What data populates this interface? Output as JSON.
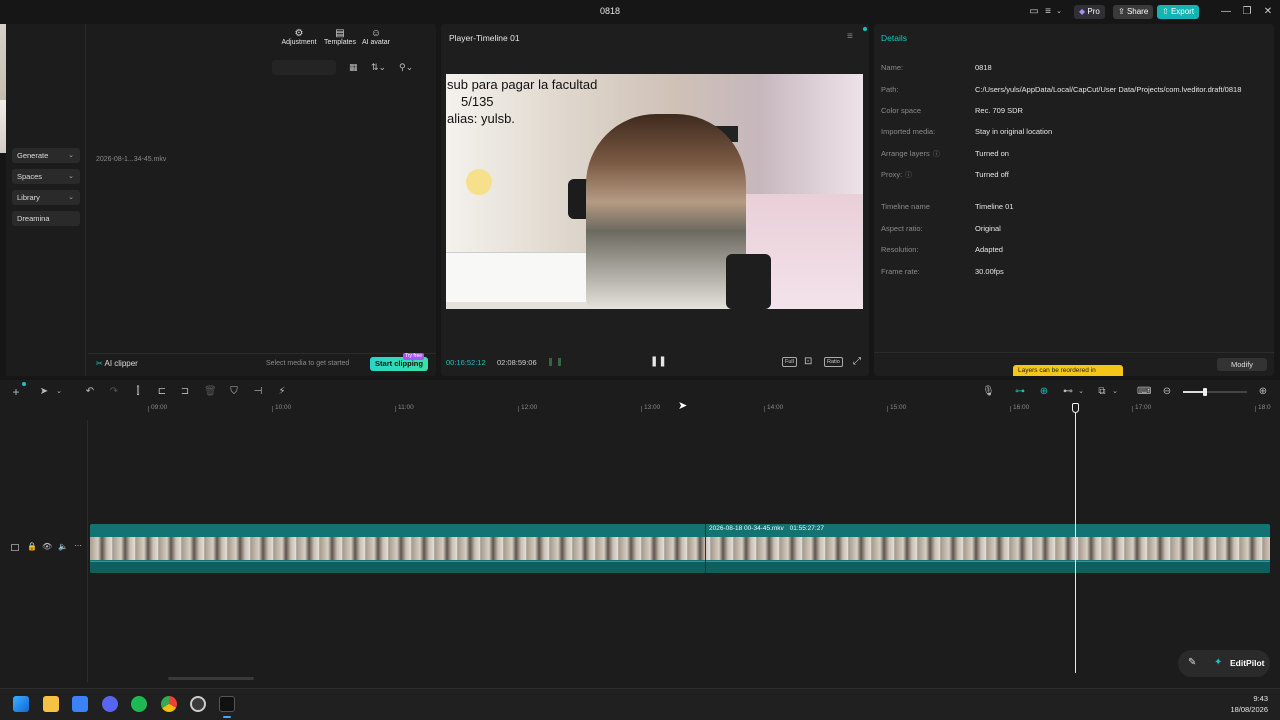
{
  "window": {
    "title": "0818"
  },
  "titlebar": {
    "pro_label": "Pro",
    "share_label": "Share",
    "export_label": "Export",
    "minimize": "—",
    "restore": "❐",
    "close": "✕"
  },
  "toolbar": {
    "items": [
      {
        "label": "Adjustment",
        "icon": "sliders-icon"
      },
      {
        "label": "Templates",
        "icon": "templates-icon"
      },
      {
        "label": "AI avatar",
        "icon": "avatar-icon"
      }
    ]
  },
  "sidebar": {
    "items": [
      {
        "label": "Generate"
      },
      {
        "label": "Spaces"
      },
      {
        "label": "Library"
      },
      {
        "label": "Dreamina"
      }
    ]
  },
  "media": {
    "file_name": "2026-08-1...34-45.mkv",
    "ai_clipper_label": "AI clipper",
    "prompt": "Select media to get started",
    "start_clipping_label": "Start clipping",
    "try_free_badge": "Try free"
  },
  "player": {
    "title": "Player-Timeline 01",
    "current_time": "00:16:52:12",
    "total_time": "02:08:59:06",
    "overlay_lines": [
      "sub para pagar la facultad",
      "5/135",
      "alias: yulsb."
    ],
    "full_label": "Full",
    "ratio_label": "Ratio"
  },
  "details": {
    "title": "Details",
    "rows": [
      {
        "key": "Name:",
        "value": "0818"
      },
      {
        "key": "Path:",
        "value": "C:/Users/yuls/AppData/Local/CapCut/User Data/Projects/com.lveditor.draft/0818"
      },
      {
        "key": "Color space",
        "value": "Rec. 709 SDR"
      },
      {
        "key": "Imported media:",
        "value": "Stay in original location"
      },
      {
        "key": "Arrange layers",
        "value": "Turned on"
      },
      {
        "key": "Proxy:",
        "value": "Turned off"
      },
      {
        "key": "Timeline name",
        "value": "Timeline 01"
      },
      {
        "key": "Aspect ratio:",
        "value": "Original"
      },
      {
        "key": "Resolution:",
        "value": "Adapted"
      },
      {
        "key": "Frame rate:",
        "value": "30.00fps"
      }
    ],
    "tooltip": "Layers can be reordered in",
    "modify_label": "Modify"
  },
  "timeline": {
    "ticks": [
      "09:00",
      "10:00",
      "11:00",
      "12:00",
      "13:00",
      "14:00",
      "15:00",
      "16:00",
      "17:00",
      "18:0"
    ],
    "clip_label": "2026-08-18 00-34-45.mkv",
    "clip_duration": "01:55:27:27",
    "playhead_position": 0.835
  },
  "editpilot": {
    "label": "EditPilot"
  },
  "taskbar": {
    "time": "9:43",
    "date": "18/08/2026"
  },
  "colors": {
    "accent": "#19c2c2",
    "export": "#15b3b3",
    "tooltip": "#f5c518"
  }
}
